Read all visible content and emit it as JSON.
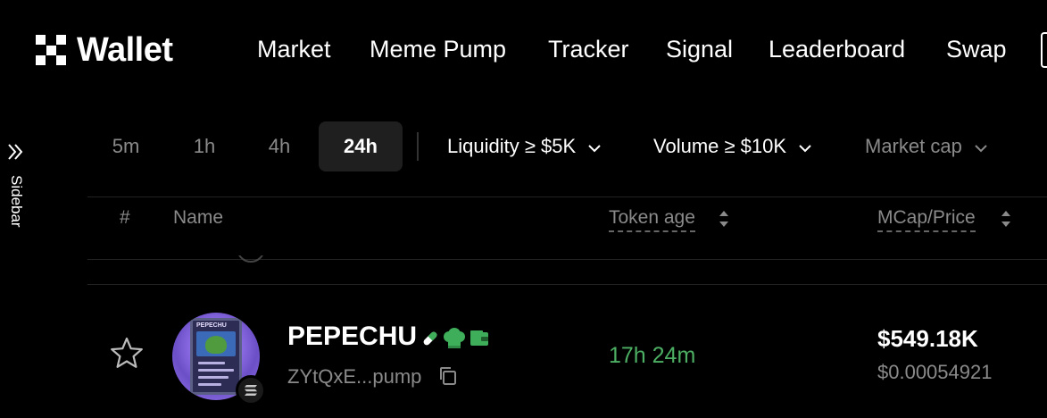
{
  "brand": {
    "name": "Wallet",
    "logo_icon": "okx-grid-icon"
  },
  "nav": {
    "items": [
      {
        "label": "Market"
      },
      {
        "label": "Meme Pump"
      },
      {
        "label": "Tracker"
      },
      {
        "label": "Signal"
      },
      {
        "label": "Leaderboard"
      },
      {
        "label": "Swap"
      }
    ]
  },
  "sidebar": {
    "label": "Sidebar",
    "icon": "double-chevron-right-icon"
  },
  "filters": {
    "timeframes": [
      {
        "label": "5m",
        "active": false
      },
      {
        "label": "1h",
        "active": false
      },
      {
        "label": "4h",
        "active": false
      },
      {
        "label": "24h",
        "active": true
      }
    ],
    "dropdowns": [
      {
        "label": "Liquidity ≥ $5K"
      },
      {
        "label": "Volume ≥ $10K"
      },
      {
        "label": "Market cap"
      }
    ]
  },
  "table": {
    "columns": {
      "index": "#",
      "name": "Name",
      "age": "Token age",
      "mcap": "MCap/Price"
    },
    "rows": [
      {
        "name": "PEPECHU",
        "address": "ZYtQxE...pump",
        "age": "17h 24m",
        "mcap": "$549.18K",
        "price": "$0.00054921",
        "chain_icon": "solana-icon",
        "badges": [
          "pill-icon",
          "chef-hat-icon",
          "wallet-icon"
        ],
        "avatar_card_title": "PEPECHU",
        "favorited": false
      }
    ]
  },
  "colors": {
    "background": "#000000",
    "active_tab_bg": "#1f1f1f",
    "muted_text": "#8a8a8a",
    "positive": "#4caf63",
    "badge_green": "#3fae5a"
  }
}
